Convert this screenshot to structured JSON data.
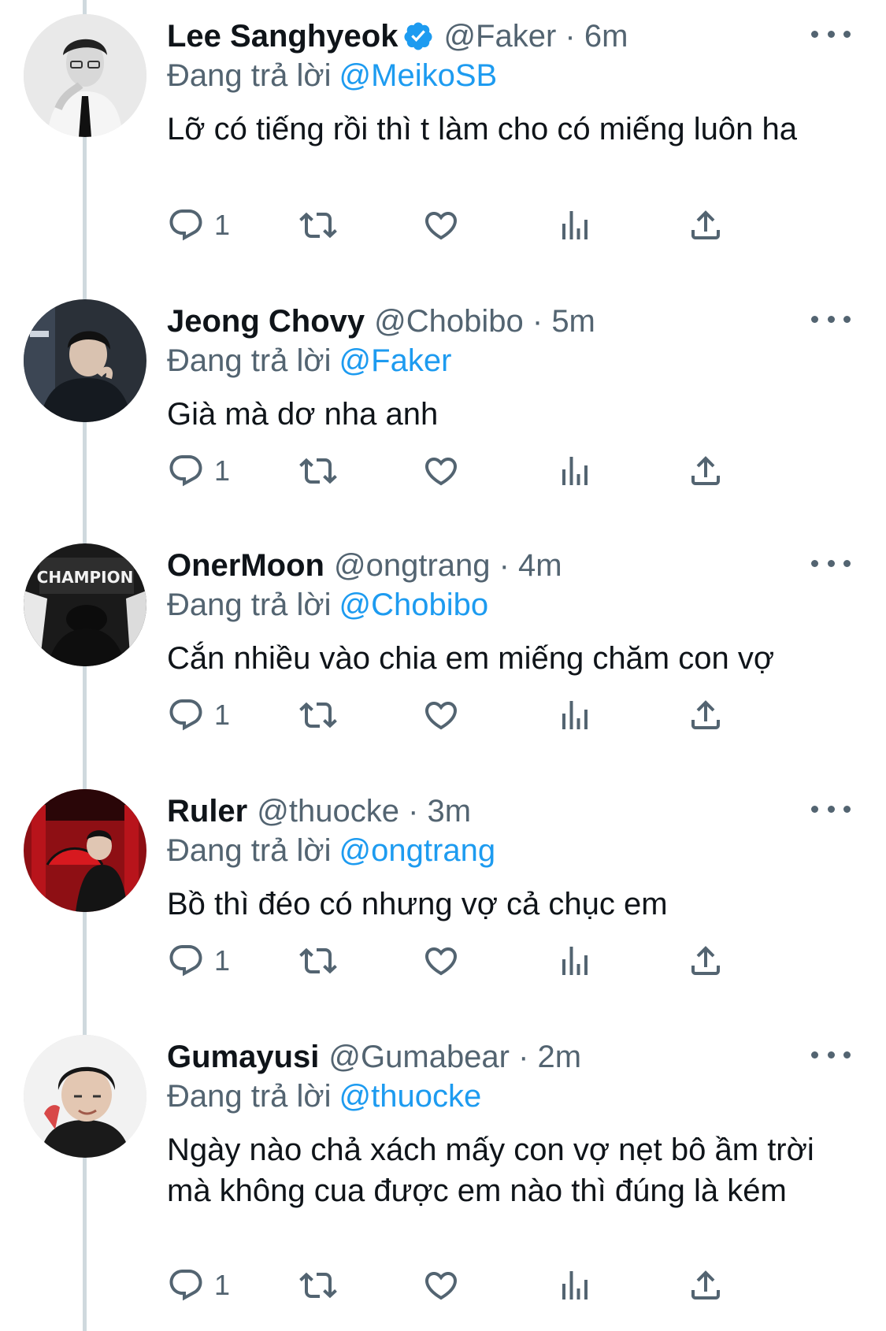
{
  "tweets": [
    {
      "name": "Lee Sanghyeok",
      "verified": true,
      "handle": "@Faker",
      "time": "6m",
      "handle_time": "@Faker · 6m",
      "replying_label": "Đang trả lời",
      "replying_to": "@MeikoSB",
      "text": "Lỡ có tiếng rồi thì t làm cho có miếng luôn ha",
      "reply_count": "1"
    },
    {
      "name": "Jeong Chovy",
      "verified": false,
      "handle": "@Chobibo",
      "time": "5m",
      "handle_time": "@Chobibo · 5m",
      "replying_label": "Đang trả lời",
      "replying_to": "@Faker",
      "text": "Già mà dơ nha anh",
      "reply_count": "1"
    },
    {
      "name": "OnerMoon",
      "verified": false,
      "handle": "@ongtrang",
      "time": "4m",
      "handle_time": "@ongtrang · 4m",
      "replying_label": "Đang trả lời",
      "replying_to": "@Chobibo",
      "text": "Cắn nhiều vào chia em miếng chăm con vợ",
      "reply_count": "1"
    },
    {
      "name": "Ruler",
      "verified": false,
      "handle": "@thuocke",
      "time": "3m",
      "handle_time": "@thuocke · 3m",
      "replying_label": "Đang trả lời",
      "replying_to": "@ongtrang",
      "text": "Bồ thì đéo có nhưng vợ cả chục em",
      "reply_count": "1"
    },
    {
      "name": "Gumayusi",
      "verified": false,
      "handle": "@Gumabear",
      "time": "2m",
      "handle_time": "@Gumabear · 2m",
      "replying_label": "Đang trả lời",
      "replying_to": "@thuocke",
      "text": "Ngày nào chả xách mấy con vợ nẹt bô ầm trời mà không cua được em nào thì đúng là kém",
      "reply_count": "1"
    }
  ],
  "avatar_texts": {
    "oner_sign": "CHAMPION"
  },
  "icons": {
    "reply": "reply-bubble-icon",
    "retweet": "retweet-icon",
    "like": "heart-icon",
    "views": "analytics-bars-icon",
    "share": "share-upload-icon",
    "more": "more-dots-icon",
    "verified": "verified-badge-icon"
  },
  "colors": {
    "text": "#0f1419",
    "secondary": "#536471",
    "link": "#1d9bf0",
    "thread_line": "#cfd9de",
    "background": "#ffffff"
  }
}
